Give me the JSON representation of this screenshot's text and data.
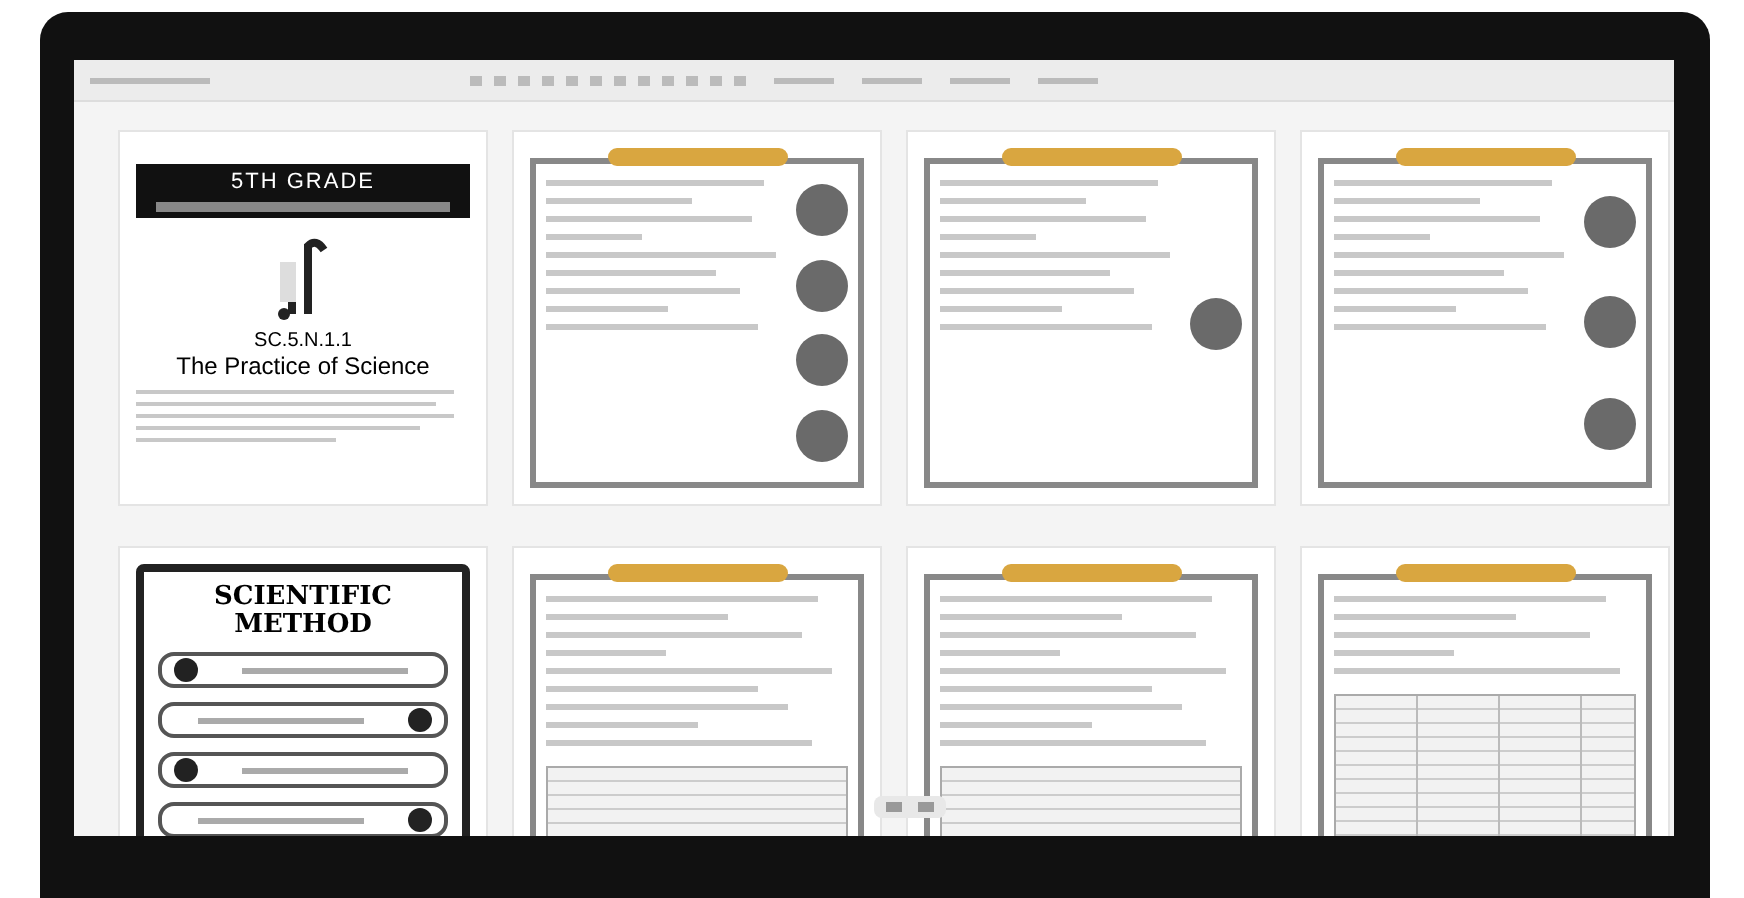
{
  "pages": [
    {
      "kind": "cover",
      "title": "5TH GRADE",
      "code": "SC.5.N.1.1",
      "subtitle": "The Practice of Science"
    },
    {
      "kind": "photos"
    },
    {
      "kind": "notes"
    },
    {
      "kind": "mixed"
    },
    {
      "kind": "method",
      "title": "SCIENTIFIC METHOD"
    },
    {
      "kind": "lined"
    },
    {
      "kind": "lined"
    },
    {
      "kind": "table"
    }
  ]
}
